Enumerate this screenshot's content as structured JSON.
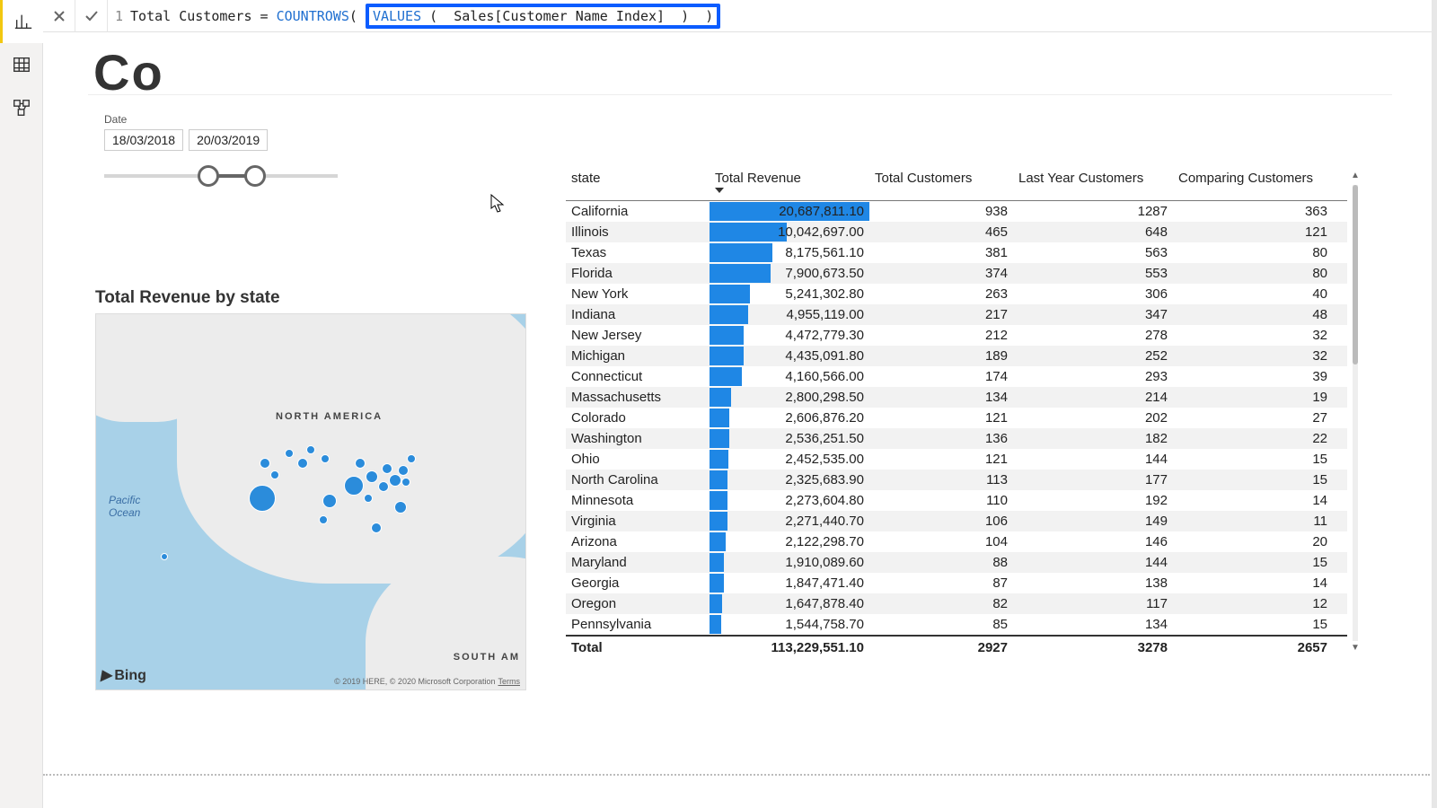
{
  "rail": {
    "report": "Report view",
    "data": "Data view",
    "model": "Model view"
  },
  "formula": {
    "line_no": "1",
    "measure_name": "Total Customers",
    "equals": " = ",
    "fn_outer": "COUNTROWS",
    "paren_open": "( ",
    "fn_inner": "VALUES",
    "paren_inner_open": "( ",
    "column": "Sales[Customer Name Index]",
    "paren_inner_close": " )",
    "paren_close": " )"
  },
  "page_title_partial": "Co",
  "slicer": {
    "label": "Date",
    "from": "18/03/2018",
    "to": "20/03/2019"
  },
  "map": {
    "title": "Total Revenue by state",
    "continent": "NORTH AMERICA",
    "continent2": "SOUTH AM",
    "ocean": "Pacific\nOcean",
    "brand": "Bing",
    "attrib": "© 2019 HERE, © 2020 Microsoft Corporation",
    "terms": "Terms"
  },
  "matrix": {
    "headers": {
      "state": "state",
      "rev": "Total Revenue",
      "cust": "Total Customers",
      "lyc": "Last Year Customers",
      "cmp": "Comparing Customers"
    },
    "rows": [
      {
        "state": "California",
        "rev": "20,687,811.10",
        "rev_raw": 20687811.1,
        "tc": "938",
        "ly": "1287",
        "cmp": "363"
      },
      {
        "state": "Illinois",
        "rev": "10,042,697.00",
        "rev_raw": 10042697.0,
        "tc": "465",
        "ly": "648",
        "cmp": "121"
      },
      {
        "state": "Texas",
        "rev": "8,175,561.10",
        "rev_raw": 8175561.1,
        "tc": "381",
        "ly": "563",
        "cmp": "80"
      },
      {
        "state": "Florida",
        "rev": "7,900,673.50",
        "rev_raw": 7900673.5,
        "tc": "374",
        "ly": "553",
        "cmp": "80"
      },
      {
        "state": "New York",
        "rev": "5,241,302.80",
        "rev_raw": 5241302.8,
        "tc": "263",
        "ly": "306",
        "cmp": "40"
      },
      {
        "state": "Indiana",
        "rev": "4,955,119.00",
        "rev_raw": 4955119.0,
        "tc": "217",
        "ly": "347",
        "cmp": "48"
      },
      {
        "state": "New Jersey",
        "rev": "4,472,779.30",
        "rev_raw": 4472779.3,
        "tc": "212",
        "ly": "278",
        "cmp": "32"
      },
      {
        "state": "Michigan",
        "rev": "4,435,091.80",
        "rev_raw": 4435091.8,
        "tc": "189",
        "ly": "252",
        "cmp": "32"
      },
      {
        "state": "Connecticut",
        "rev": "4,160,566.00",
        "rev_raw": 4160566.0,
        "tc": "174",
        "ly": "293",
        "cmp": "39"
      },
      {
        "state": "Massachusetts",
        "rev": "2,800,298.50",
        "rev_raw": 2800298.5,
        "tc": "134",
        "ly": "214",
        "cmp": "19"
      },
      {
        "state": "Colorado",
        "rev": "2,606,876.20",
        "rev_raw": 2606876.2,
        "tc": "121",
        "ly": "202",
        "cmp": "27"
      },
      {
        "state": "Washington",
        "rev": "2,536,251.50",
        "rev_raw": 2536251.5,
        "tc": "136",
        "ly": "182",
        "cmp": "22"
      },
      {
        "state": "Ohio",
        "rev": "2,452,535.00",
        "rev_raw": 2452535.0,
        "tc": "121",
        "ly": "144",
        "cmp": "15"
      },
      {
        "state": "North Carolina",
        "rev": "2,325,683.90",
        "rev_raw": 2325683.9,
        "tc": "113",
        "ly": "177",
        "cmp": "15"
      },
      {
        "state": "Minnesota",
        "rev": "2,273,604.80",
        "rev_raw": 2273604.8,
        "tc": "110",
        "ly": "192",
        "cmp": "14"
      },
      {
        "state": "Virginia",
        "rev": "2,271,440.70",
        "rev_raw": 2271440.7,
        "tc": "106",
        "ly": "149",
        "cmp": "11"
      },
      {
        "state": "Arizona",
        "rev": "2,122,298.70",
        "rev_raw": 2122298.7,
        "tc": "104",
        "ly": "146",
        "cmp": "20"
      },
      {
        "state": "Maryland",
        "rev": "1,910,089.60",
        "rev_raw": 1910089.6,
        "tc": "88",
        "ly": "144",
        "cmp": "15"
      },
      {
        "state": "Georgia",
        "rev": "1,847,471.40",
        "rev_raw": 1847471.4,
        "tc": "87",
        "ly": "138",
        "cmp": "14"
      },
      {
        "state": "Oregon",
        "rev": "1,647,878.40",
        "rev_raw": 1647878.4,
        "tc": "82",
        "ly": "117",
        "cmp": "12"
      },
      {
        "state": "Pennsylvania",
        "rev": "1,544,758.70",
        "rev_raw": 1544758.7,
        "tc": "85",
        "ly": "134",
        "cmp": "15"
      }
    ],
    "total": {
      "label": "Total",
      "rev": "113,229,551.10",
      "tc": "2927",
      "ly": "3278",
      "cmp": "2657"
    }
  },
  "chart_data": {
    "type": "table",
    "title": "Total Revenue by state (matrix)",
    "columns": [
      "state",
      "Total Revenue",
      "Total Customers",
      "Last Year Customers",
      "Comparing Customers"
    ],
    "rows": [
      [
        "California",
        20687811.1,
        938,
        1287,
        363
      ],
      [
        "Illinois",
        10042697.0,
        465,
        648,
        121
      ],
      [
        "Texas",
        8175561.1,
        381,
        563,
        80
      ],
      [
        "Florida",
        7900673.5,
        374,
        553,
        80
      ],
      [
        "New York",
        5241302.8,
        263,
        306,
        40
      ],
      [
        "Indiana",
        4955119.0,
        217,
        347,
        48
      ],
      [
        "New Jersey",
        4472779.3,
        212,
        278,
        32
      ],
      [
        "Michigan",
        4435091.8,
        189,
        252,
        32
      ],
      [
        "Connecticut",
        4160566.0,
        174,
        293,
        39
      ],
      [
        "Massachusetts",
        2800298.5,
        134,
        214,
        19
      ],
      [
        "Colorado",
        2606876.2,
        121,
        202,
        27
      ],
      [
        "Washington",
        2536251.5,
        136,
        182,
        22
      ],
      [
        "Ohio",
        2452535.0,
        121,
        144,
        15
      ],
      [
        "North Carolina",
        2325683.9,
        113,
        177,
        15
      ],
      [
        "Minnesota",
        2273604.8,
        110,
        192,
        14
      ],
      [
        "Virginia",
        2271440.7,
        106,
        149,
        11
      ],
      [
        "Arizona",
        2122298.7,
        104,
        146,
        20
      ],
      [
        "Maryland",
        1910089.6,
        88,
        144,
        15
      ],
      [
        "Georgia",
        1847471.4,
        87,
        138,
        14
      ],
      [
        "Oregon",
        1647878.4,
        82,
        117,
        12
      ],
      [
        "Pennsylvania",
        1544758.7,
        85,
        134,
        15
      ]
    ],
    "total": [
      "Total",
      113229551.1,
      2927,
      3278,
      2657
    ]
  }
}
